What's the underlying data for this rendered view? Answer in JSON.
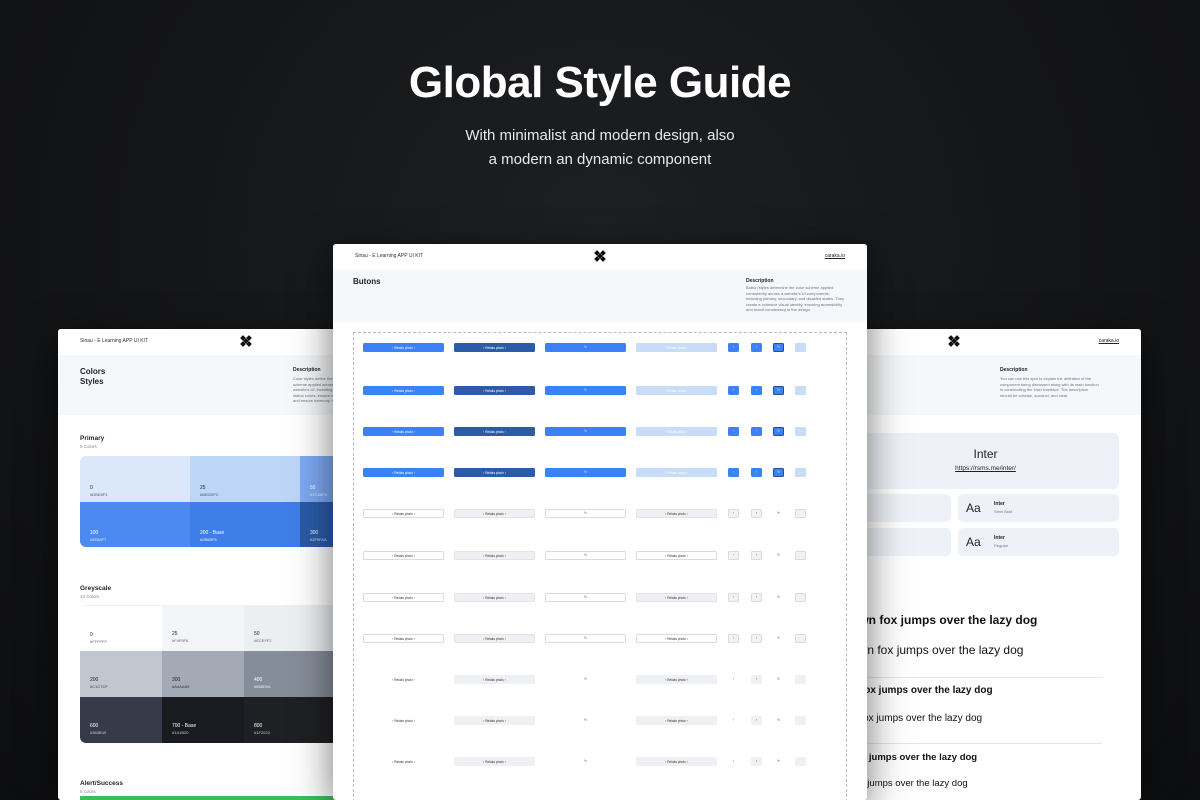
{
  "hero": {
    "title": "Global Style Guide",
    "subtitle_line1": "With minimalist and modern design, also",
    "subtitle_line2": "a modern an dynamic component"
  },
  "kit": {
    "title": "Sinau - E Learning APP UI KIT",
    "link": "caraka.io"
  },
  "colors": {
    "accent_blue": "#3B82F6",
    "dark_blue": "#2B5CA8",
    "light_blue": "#C9DCF7",
    "background": "#141517"
  },
  "center_card": {
    "section_title": "Butons",
    "description_label": "Description",
    "description": "Button styles determine the color scheme applied consistently across a website's UI components, including primary, secondary, and disabled states. They create a cohesive visual identity, ensuring accessibility and brand consistency in the design.",
    "button_label": "Relaks photo",
    "icon": "refresh-icon"
  },
  "left_card": {
    "section_title_line1": "Colors",
    "section_title_line2": "Styles",
    "description_label": "Description",
    "description": "Color styles define the color scheme applied across a website's UI, including text, and status colors, ensure consistency and ensure harmony, the design.",
    "primary": {
      "title": "Primary",
      "count": "9 Colors",
      "swatches": [
        {
          "name": "0",
          "hex": "#DBE8F3"
        },
        {
          "name": "25",
          "hex": "#BEDDFC"
        },
        {
          "name": "50",
          "hex": "#7CA8F8"
        },
        {
          "name": "100",
          "hex": "#4E88F7"
        },
        {
          "name": "200 - Base",
          "hex": "#2B6BF6"
        },
        {
          "name": "300",
          "hex": "#2F5FAA"
        }
      ]
    },
    "greyscale": {
      "title": "Greyscale",
      "count": "12 Colors",
      "swatches": [
        {
          "name": "0",
          "hex": "#FFFFFF"
        },
        {
          "name": "25",
          "hex": "#F4F5F6"
        },
        {
          "name": "50",
          "hex": "#ECEFF2"
        },
        {
          "name": "200",
          "hex": "#C1C7CF"
        },
        {
          "name": "300",
          "hex": "#A4AAB5"
        },
        {
          "name": "400",
          "hex": "#868D9A"
        },
        {
          "name": "600",
          "hex": "#363B49"
        },
        {
          "name": "700 - Base",
          "hex": "#1A1B20"
        },
        {
          "name": "800",
          "hex": "#1F2023"
        }
      ]
    },
    "alert": {
      "title": "Alert/Success",
      "count": "6 colors"
    }
  },
  "right_card": {
    "description_label": "Description",
    "description": "You can use this spot to explain the definition of the component being discussed along with its main function in constructing the User Interface. The description should be concise, succinct, and clear.",
    "font_name": "Inter",
    "font_link": "https://rsms.me/inter/",
    "weights": [
      {
        "aa": "Aa",
        "name": "Inter",
        "style": "Semi Bold"
      },
      {
        "aa": "Aa",
        "name": "Inter",
        "style": "Regular"
      }
    ],
    "samples": [
      "own fox jumps over the lazy dog",
      "own fox jumps over the lazy dog",
      "n fox jumps over the lazy dog",
      "n fox jumps over the lazy dog",
      "fox jumps over the lazy dog",
      "fox jumps over the lazy dog"
    ]
  }
}
